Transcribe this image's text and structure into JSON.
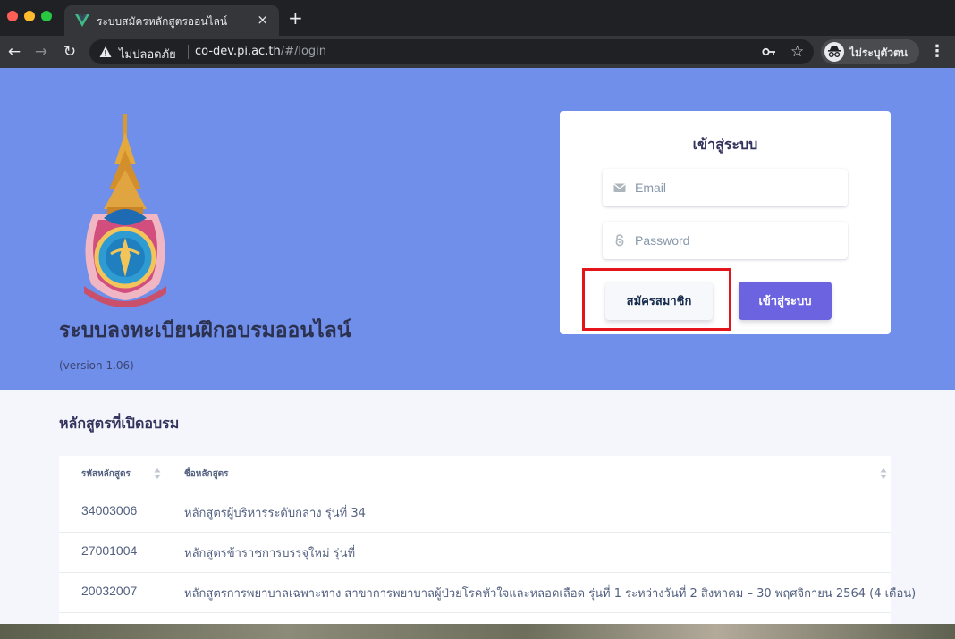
{
  "browser": {
    "tab_title": "ระบบสมัครหลักสูตรออนไลน์",
    "tab_close": "×",
    "new_tab": "+",
    "security_label": "ไม่ปลอดภัย",
    "url_host": "co-dev.pi.ac.th",
    "url_path": "/#/login",
    "profile_label": "ไม่ระบุตัวตน",
    "menu": "⋮",
    "star": "☆",
    "back": "←",
    "forward": "→",
    "reload": "↻"
  },
  "hero": {
    "system_title": "ระบบลงทะเบียนฝึกอบรมออนไลน์",
    "version": "(version 1.06)"
  },
  "login": {
    "title": "เข้าสู่ระบบ",
    "email_placeholder": "Email",
    "password_placeholder": "Password",
    "register_button": "สมัครสมาชิก",
    "login_button": "เข้าสู่ระบบ"
  },
  "courses": {
    "heading": "หลักสูตรที่เปิดอบรม",
    "columns": [
      "รหัสหลักสูตร",
      "ชื่อหลักสูตร"
    ],
    "rows": [
      {
        "code": "34003006",
        "name": "หลักสูตรผู้บริหารระดับกลาง รุ่นที่ 34"
      },
      {
        "code": "27001004",
        "name": "หลักสูตรข้าราชการบรรจุใหม่ รุ่นที่"
      },
      {
        "code": "20032007",
        "name": "หลักสูตรการพยาบาลเฉพาะทาง สาขาการพยาบาลผู้ป่วยโรคหัวใจและหลอดเลือด รุ่นที่ 1 ระหว่างวันที่ 2 สิงหาคม – 30 พฤศจิกายน 2564 (4 เดือน)"
      }
    ]
  },
  "colors": {
    "hero_bg": "#6f8fea",
    "login_button": "#6c63e0",
    "highlight": "#e3151a"
  }
}
